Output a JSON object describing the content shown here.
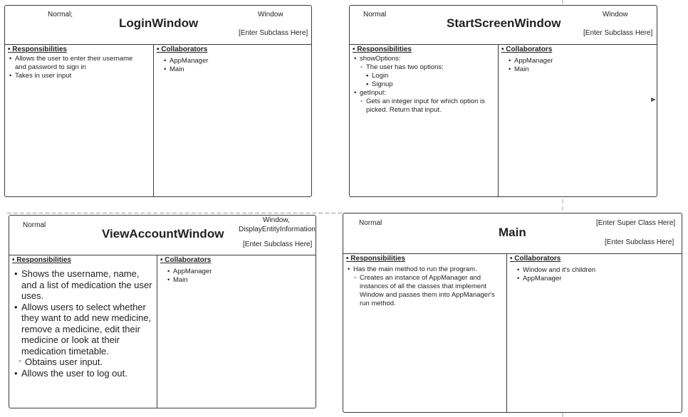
{
  "cards": {
    "login": {
      "stereotype": "Normal;",
      "super_label": "Window",
      "title": "LoginWindow",
      "subclass": "[Enter Subclass Here]",
      "responsibilities_heading": "Responsibilities",
      "responsibilities": [
        {
          "text": "Allows the user to enter their username",
          "level": 1
        },
        {
          "text": "and password to sign in",
          "level": 1,
          "cont": true
        },
        {
          "text": "Takes in user input",
          "level": 1
        }
      ],
      "collaborators_heading": "Collaborators",
      "collaborators": [
        "AppManager",
        "Main"
      ]
    },
    "start": {
      "stereotype": "Normal",
      "super_label": "Window",
      "title": "StartScreenWindow",
      "subclass": "[Enter Subclass Here]",
      "responsibilities_heading": "Responsibilities",
      "responsibilities": [
        {
          "text": "showOptions:",
          "level": 1
        },
        {
          "text": "The user has two options:",
          "level": 2
        },
        {
          "text": "Login",
          "level": 3
        },
        {
          "text": "Signup",
          "level": 3
        },
        {
          "text": "getInput:",
          "level": 1
        },
        {
          "text": "Gets an integer input for which option is picked. Return that input.",
          "level": 2
        }
      ],
      "collaborators_heading": "Collaborators",
      "collaborators": [
        "AppManager",
        "Main"
      ]
    },
    "view": {
      "stereotype": "Normal",
      "super_label": "Window,",
      "super_label_2": "DisplayEntityInformation",
      "title": "ViewAccountWindow",
      "subclass": "[Enter Subclass Here]",
      "responsibilities_heading": "Responsibilities",
      "responsibilities": [
        {
          "text": "Shows the username, name, and a list of medication the user uses.",
          "level": 1
        },
        {
          "text": "Allows users to select whether they want to add new medicine, remove a medicine, edit their medicine or look at their medication timetable.",
          "level": 1
        },
        {
          "text": "Obtains user input.",
          "level": 2
        },
        {
          "text": "Allows the user to log out.",
          "level": 1
        }
      ],
      "collaborators_heading": "Collaborators",
      "collaborators": [
        "AppManager",
        "Main"
      ]
    },
    "main": {
      "stereotype": "Normal",
      "super_label": "[Enter Super Class Here]",
      "title": "Main",
      "subclass": "[Enter Subclass Here]",
      "responsibilities_heading": "Responsibilities",
      "responsibilities": [
        {
          "text": "Has the main method to run the program.",
          "level": 1
        },
        {
          "text": "Creates an instance of AppManager and instances of all the classes that implement Window and passes them into AppManager's run method.",
          "level": 2
        }
      ],
      "collaborators_heading": "Collaborators",
      "collaborators": [
        "Window and it's children",
        "AppManager"
      ]
    }
  }
}
